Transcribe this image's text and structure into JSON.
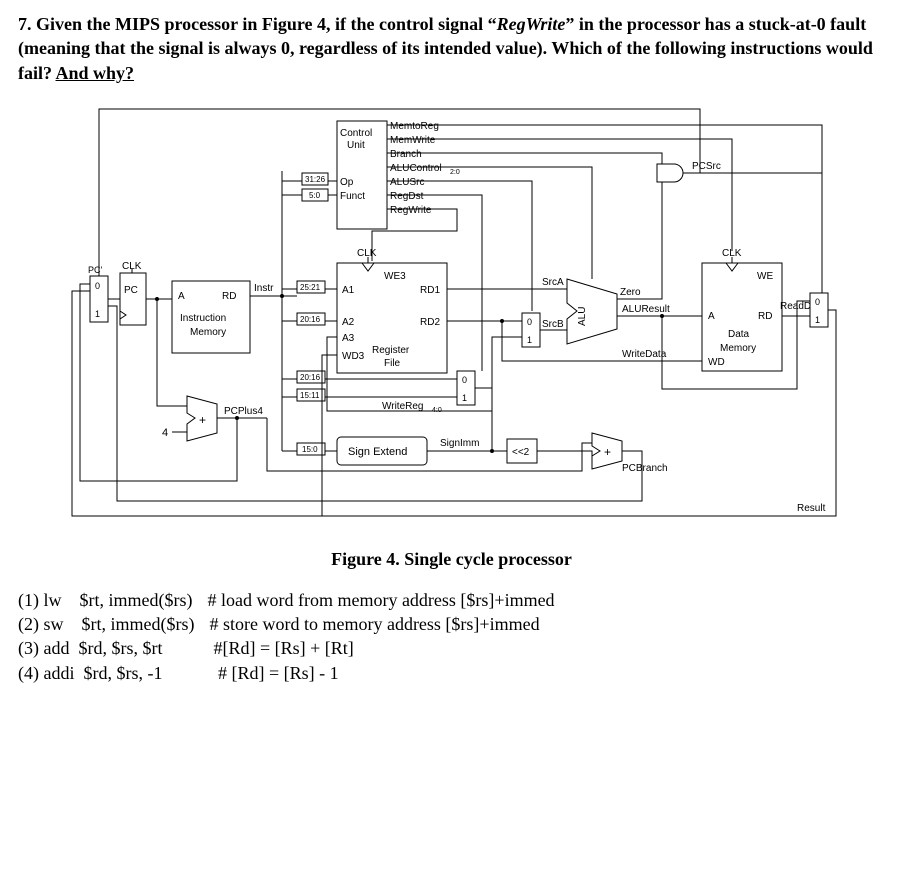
{
  "question": {
    "prefix": "7. Given the MIPS processor in Figure 4, if the control signal “",
    "signal": "RegWrite",
    "middle": "” in the processor has a stuck-at-0 fault (meaning that the signal is always 0, regardless of its intended value). Which of the following instructions would fail? ",
    "underline": "And why?"
  },
  "diagram": {
    "caption": "Figure 4. Single cycle processor",
    "labels": {
      "clk1": "CLK",
      "clk2": "CLK",
      "clk3": "CLK",
      "pcprime": "PC'",
      "pc": "PC",
      "instrA": "A",
      "instrRD": "RD",
      "instr_mem1": "Instruction",
      "instr_mem2": "Memory",
      "instr": "Instr",
      "ctrl1": "Control",
      "ctrl2": "Unit",
      "ctrl_mtr": "MemtoReg",
      "ctrl_mw": "MemWrite",
      "ctrl_br": "Branch",
      "ctrl_aluc": "ALUControl",
      "ctrl_aluc_sub": "2:0",
      "ctrl_alusrc": "ALUSrc",
      "ctrl_regdst": "RegDst",
      "ctrl_regwrite": "RegWrite",
      "ctrl_op": "Op",
      "ctrl_funct": "Funct",
      "bits_3126": "31:26",
      "bits_50": "5:0",
      "bits_2521": "25:21",
      "bits_2016a": "20:16",
      "bits_2016b": "20:16",
      "bits_1511": "15:11",
      "bits_150": "15:0",
      "rf_we3": "WE3",
      "rf_a1": "A1",
      "rf_a2": "A2",
      "rf_a3": "A3",
      "rf_wd3": "WD3",
      "rf_rd1": "RD1",
      "rf_rd2": "RD2",
      "rf_name1": "Register",
      "rf_name2": "File",
      "writereg": "WriteReg",
      "writereg_sub": "4:0",
      "signext": "Sign Extend",
      "signimm": "SignImm",
      "mux0": "0",
      "mux1": "1",
      "srca": "SrcA",
      "srcb": "SrcB",
      "alu": "ALU",
      "zero": "Zero",
      "aluresult": "ALUResult",
      "writedata": "WriteData",
      "shl2": "<<2",
      "pcbranch": "PCBranch",
      "pcplus4": "PCPlus4",
      "four": "4",
      "pcsrc": "PCSrc",
      "dm_a": "A",
      "dm_rd": "RD",
      "dm_name1": "Data",
      "dm_name2": "Memory",
      "dm_wd": "WD",
      "dm_we": "WE",
      "readdata": "ReadData",
      "result": "Result"
    }
  },
  "options": {
    "o1_num": "(1) lw",
    "o1_args": "$rt,  immed($rs)",
    "o1_comment": "# load word from memory address [$rs]+immed",
    "o2_num": "(2) sw",
    "o2_args": "$rt,  immed($rs)",
    "o2_comment": "# store word to memory address [$rs]+immed",
    "o3_num": "(3) add",
    "o3_args": "$rd, $rs, $rt",
    "o3_comment": "#[Rd] = [Rs] + [Rt]",
    "o4_num": "(4) addi",
    "o4_args": "$rd, $rs, -1",
    "o4_comment": "# [Rd] = [Rs] - 1"
  }
}
